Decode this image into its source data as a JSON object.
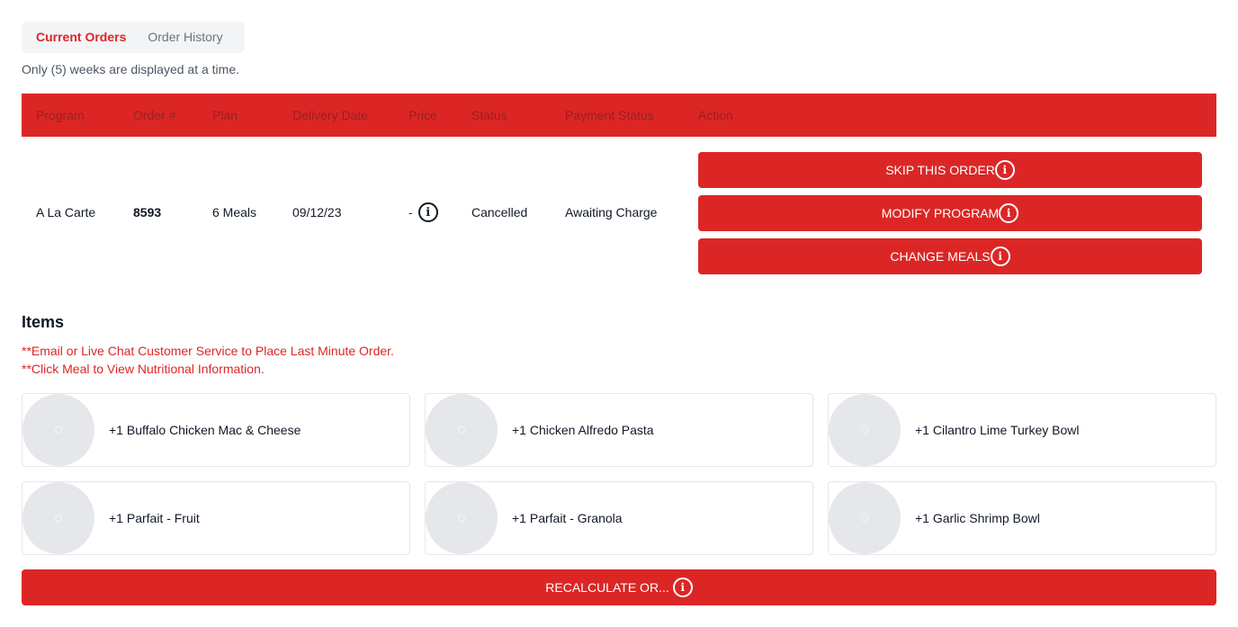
{
  "tabs": {
    "current": "Current Orders",
    "history": "Order History"
  },
  "notice": "Only (5) weeks are displayed at a time.",
  "table": {
    "headers": [
      "Program",
      "Order #",
      "Plan",
      "Delivery Date",
      "Price",
      "Status",
      "Payment Status",
      "Action"
    ],
    "row": {
      "program": "A La Carte",
      "order_number": "8593",
      "plan": "6 Meals",
      "delivery_date": "09/12/23",
      "price": "-",
      "status": "Cancelled",
      "payment_status": "Awaiting Charge"
    },
    "actions": {
      "skip": "SKIP THIS ORDER",
      "modify": "MODIFY PROGRAM",
      "change": "CHANGE MEALS"
    }
  },
  "items": {
    "title": "Items",
    "note1": "**Email or Live Chat Customer Service to Place Last Minute Order.",
    "note2": "**Click Meal to View Nutritional Information.",
    "meals": [
      "+1 Buffalo Chicken Mac & Cheese",
      "+1 Chicken Alfredo Pasta",
      "+1 Cilantro Lime Turkey Bowl",
      "+1 Parfait - Fruit",
      "+1 Parfait - Granola",
      "+1 Garlic Shrimp Bowl"
    ]
  },
  "recalculate": "RECALCULATE OR...",
  "icons": {
    "info": "info-icon",
    "meal_placeholder": "meal-image-placeholder"
  },
  "colors": {
    "brand_red": "#dc2626",
    "header_text": "#9a1f1f"
  }
}
